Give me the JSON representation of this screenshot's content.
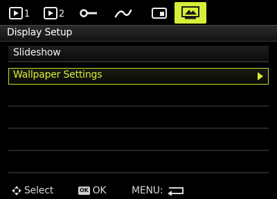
{
  "tabs": [
    {
      "icon": "play-icon",
      "number": "1"
    },
    {
      "icon": "play-icon",
      "number": "2"
    },
    {
      "icon": "wrench-setup-icon"
    },
    {
      "icon": "connection-cable-icon"
    },
    {
      "icon": "memory-card-icon"
    },
    {
      "icon": "monitor-display-icon",
      "active": true
    }
  ],
  "header": {
    "title": "Display Setup"
  },
  "menu": {
    "items": [
      {
        "label": "Slideshow",
        "selected": false
      },
      {
        "label": "Wallpaper Settings",
        "selected": true,
        "has_submenu": true
      }
    ]
  },
  "footer": {
    "select_label": "Select",
    "ok_badge": "OK",
    "ok_label": "OK",
    "menu_label": "MENU:"
  },
  "colors": {
    "accent": "#d6ee3a",
    "background": "#000000",
    "text": "#f0f0f0"
  }
}
